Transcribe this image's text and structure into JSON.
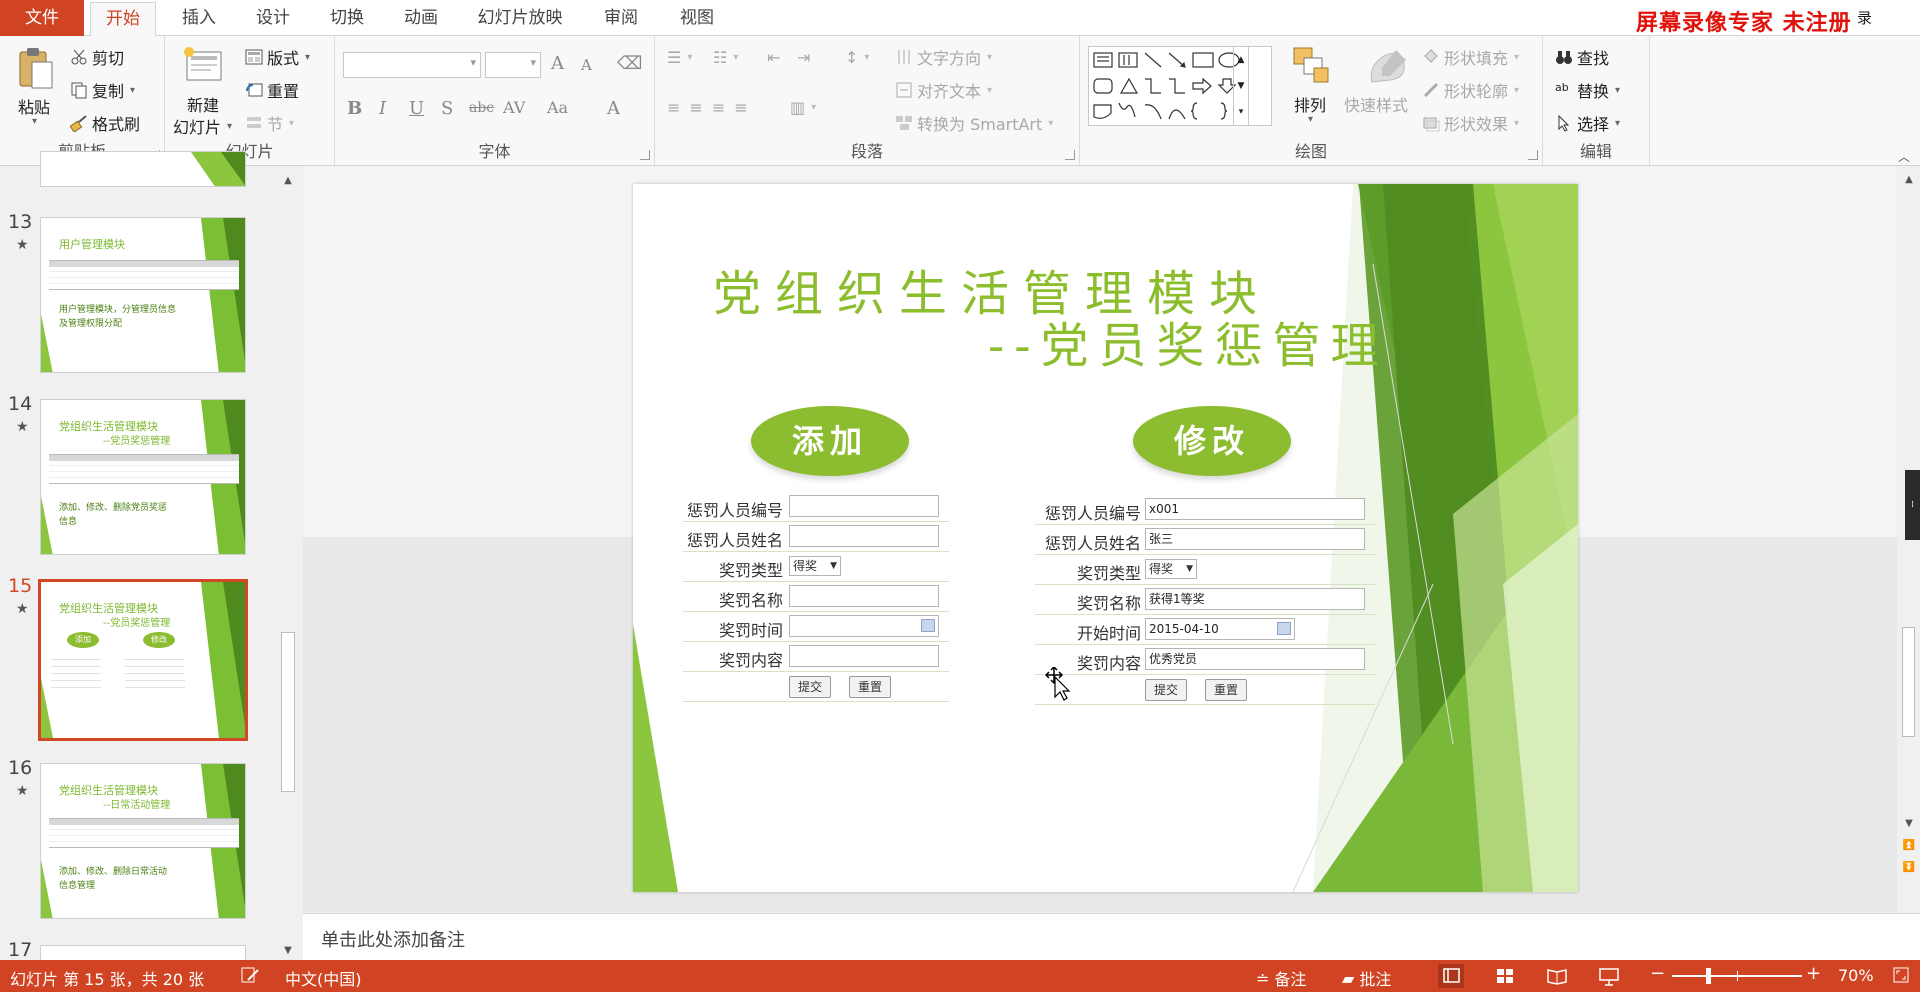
{
  "tabs": {
    "file": "文件",
    "items": [
      "开始",
      "插入",
      "设计",
      "切换",
      "动画",
      "幻灯片放映",
      "审阅",
      "视图"
    ],
    "active_index": 0
  },
  "watermark": {
    "text": "屏幕录像专家  未注册",
    "suffix": "录"
  },
  "ribbon": {
    "clipboard": {
      "label": "剪贴板",
      "paste": "粘贴",
      "cut": "剪切",
      "copy": "复制",
      "format_painter": "格式刷"
    },
    "slides": {
      "label": "幻灯片",
      "new_slide_line1": "新建",
      "new_slide_line2": "幻灯片",
      "layout": "版式",
      "reset": "重置",
      "section": "节"
    },
    "font": {
      "label": "字体",
      "grow": "A",
      "shrink": "A",
      "bold": "B",
      "italic": "I",
      "underline": "U",
      "shadow": "S",
      "strike": "abc",
      "spacing": "AV",
      "case": "Aa",
      "color": "A"
    },
    "paragraph": {
      "label": "段落",
      "text_direction": "文字方向",
      "align_text": "对齐文本",
      "smartart": "转换为 SmartArt"
    },
    "drawing": {
      "label": "绘图",
      "arrange": "排列",
      "quick_styles": "快速样式",
      "shape_fill": "形状填充",
      "shape_outline": "形状轮廓",
      "shape_effects": "形状效果"
    },
    "editing": {
      "label": "编辑",
      "find": "查找",
      "replace": "替换",
      "select": "选择"
    }
  },
  "thumbnails": [
    {
      "num": "13",
      "title": "用户管理模块",
      "notes": [
        "用户管理模块，分管理员信息",
        "及管理权限分配"
      ],
      "selected": false
    },
    {
      "num": "14",
      "title": "党组织生活管理模块",
      "sub": "--党员奖惩管理",
      "notes": [
        "添加、修改、删除党员奖惩",
        "信息"
      ],
      "selected": false
    },
    {
      "num": "15",
      "title": "党组织生活管理模块",
      "sub": "--党员奖惩管理",
      "ovals": [
        "添加",
        "修改"
      ],
      "selected": true
    },
    {
      "num": "16",
      "title": "党组织生活管理模块",
      "sub": "--日常活动管理",
      "notes": [
        "添加、修改、删除日常活动",
        "信息管理"
      ],
      "selected": false
    },
    {
      "num": "17"
    }
  ],
  "slide": {
    "title": "党组织生活管理模块",
    "subtitle": "--党员奖惩管理",
    "add_label": "添加",
    "edit_label": "修改",
    "add_form": {
      "rows": [
        {
          "label": "惩罚人员编号",
          "value": ""
        },
        {
          "label": "惩罚人员姓名",
          "value": ""
        },
        {
          "label": "奖罚类型",
          "value": "得奖"
        },
        {
          "label": "奖罚名称",
          "value": ""
        },
        {
          "label": "奖罚时间",
          "value": ""
        },
        {
          "label": "奖罚内容",
          "value": ""
        }
      ],
      "submit": "提交",
      "reset": "重置"
    },
    "edit_form": {
      "rows": [
        {
          "label": "惩罚人员编号",
          "value": "x001"
        },
        {
          "label": "惩罚人员姓名",
          "value": "张三"
        },
        {
          "label": "奖罚类型",
          "value": "得奖"
        },
        {
          "label": "奖罚名称",
          "value": "获得1等奖"
        },
        {
          "label": "开始时间",
          "value": "2015-04-10"
        },
        {
          "label": "奖罚内容",
          "value": "优秀党员"
        }
      ],
      "submit": "提交",
      "reset": "重置"
    }
  },
  "notes_placeholder": "单击此处添加备注",
  "status": {
    "slide_info": "幻灯片 第 15 张，共 20 张",
    "language": "中文(中国)",
    "notes": "备注",
    "comments": "批注",
    "zoom": "70%"
  },
  "colors": {
    "accent": "#d04423",
    "slide_green": "#8bbd2d",
    "dark_green": "#4e8a1e"
  }
}
